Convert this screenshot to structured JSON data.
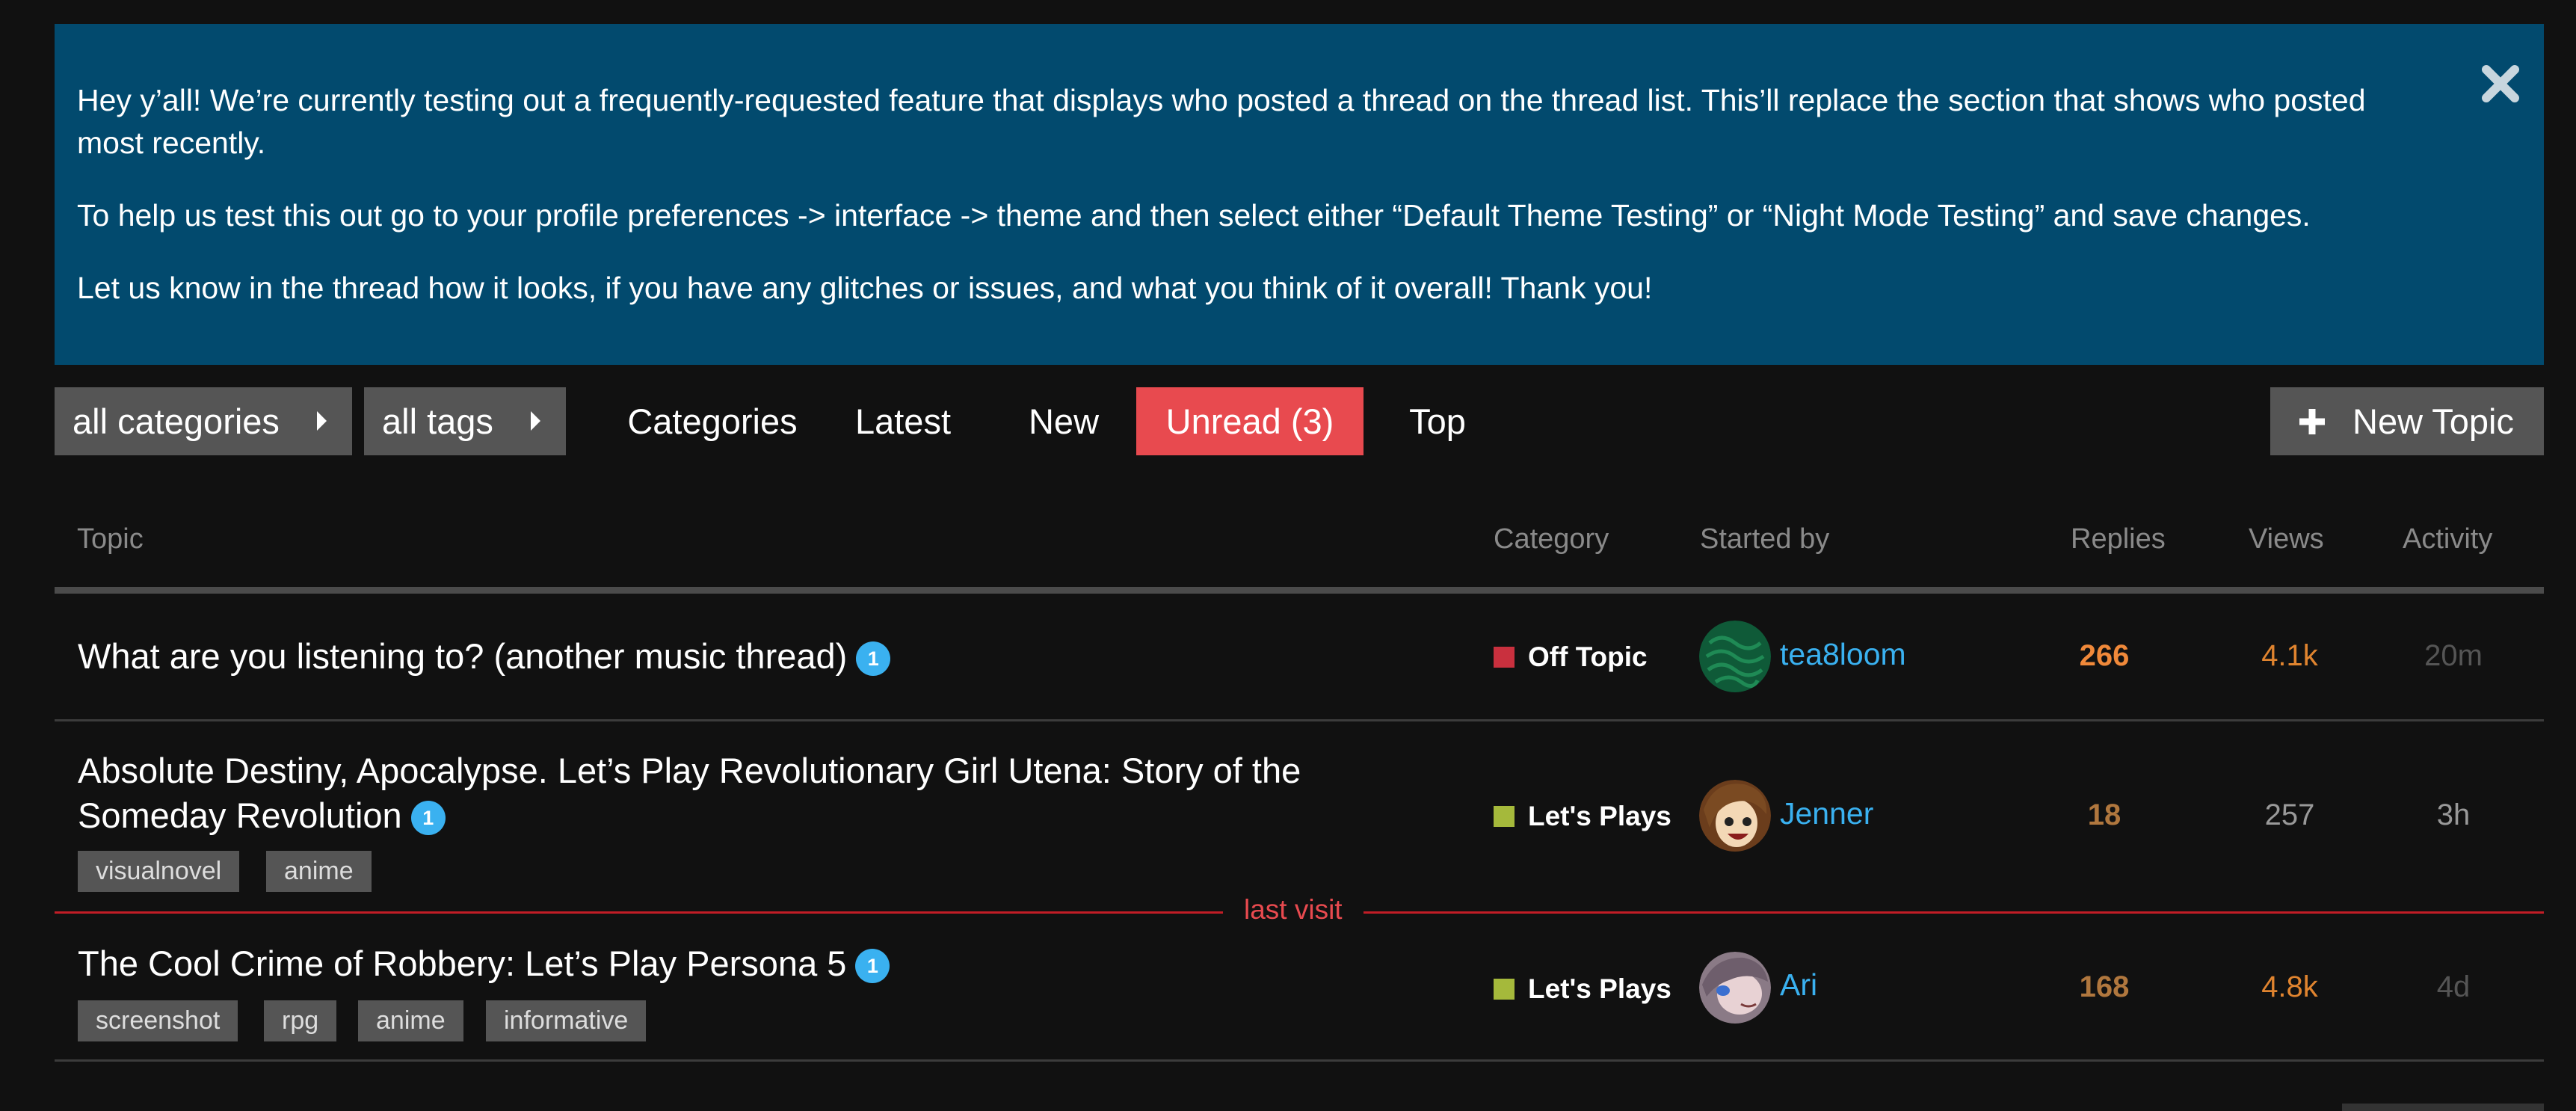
{
  "banner": {
    "paragraphs": [
      "Hey y’all! We’re currently testing out a frequently-requested feature that displays who posted a thread on the thread list. This’ll replace the section that shows who posted most recently.",
      "To help us test this out go to your profile preferences -> interface -> theme and then select either “Default Theme Testing” or “Night Mode Testing” and save changes.",
      "Let us know in the thread how it looks, if you have any glitches or issues, and what you think of it overall! Thank you!"
    ],
    "close_icon": "close-icon",
    "background": "#024a6e"
  },
  "nav": {
    "categories_dropdown": "all categories",
    "tags_dropdown": "all tags",
    "links": [
      "Categories",
      "Latest",
      "New",
      "Unread (3)",
      "Top"
    ],
    "active": "Unread (3)",
    "new_topic": "New Topic",
    "active_color": "#e84a4f"
  },
  "table": {
    "headers": {
      "topic": "Topic",
      "category": "Category",
      "started_by": "Started by",
      "replies": "Replies",
      "views": "Views",
      "activity": "Activity"
    },
    "rows": [
      {
        "title": "What are you listening to? (another music thread)",
        "unread": "1",
        "tags": [],
        "category": "Off Topic",
        "category_color": "#c9303e",
        "user": "tea8loom",
        "replies": "266",
        "views": "4.1k",
        "activity": "20m"
      },
      {
        "title_line1": "Absolute Destiny, Apocalypse. Let’s Play Revolutionary Girl Utena: Story of the",
        "title_line2": "Someday Revolution",
        "unread": "1",
        "tags": [
          "visualnovel",
          "anime"
        ],
        "category": "Let's Plays",
        "category_color": "#a5b93b",
        "user": "Jenner",
        "replies": "18",
        "views": "257",
        "activity": "3h"
      },
      {
        "title": "The Cool Crime of Robbery: Let’s Play Persona 5",
        "unread": "1",
        "tags": [
          "screenshot",
          "rpg",
          "anime",
          "informative"
        ],
        "category": "Let's Plays",
        "category_color": "#a5b93b",
        "user": "Ari",
        "replies": "168",
        "views": "4.8k",
        "activity": "4d"
      }
    ],
    "last_visit": "last visit"
  }
}
